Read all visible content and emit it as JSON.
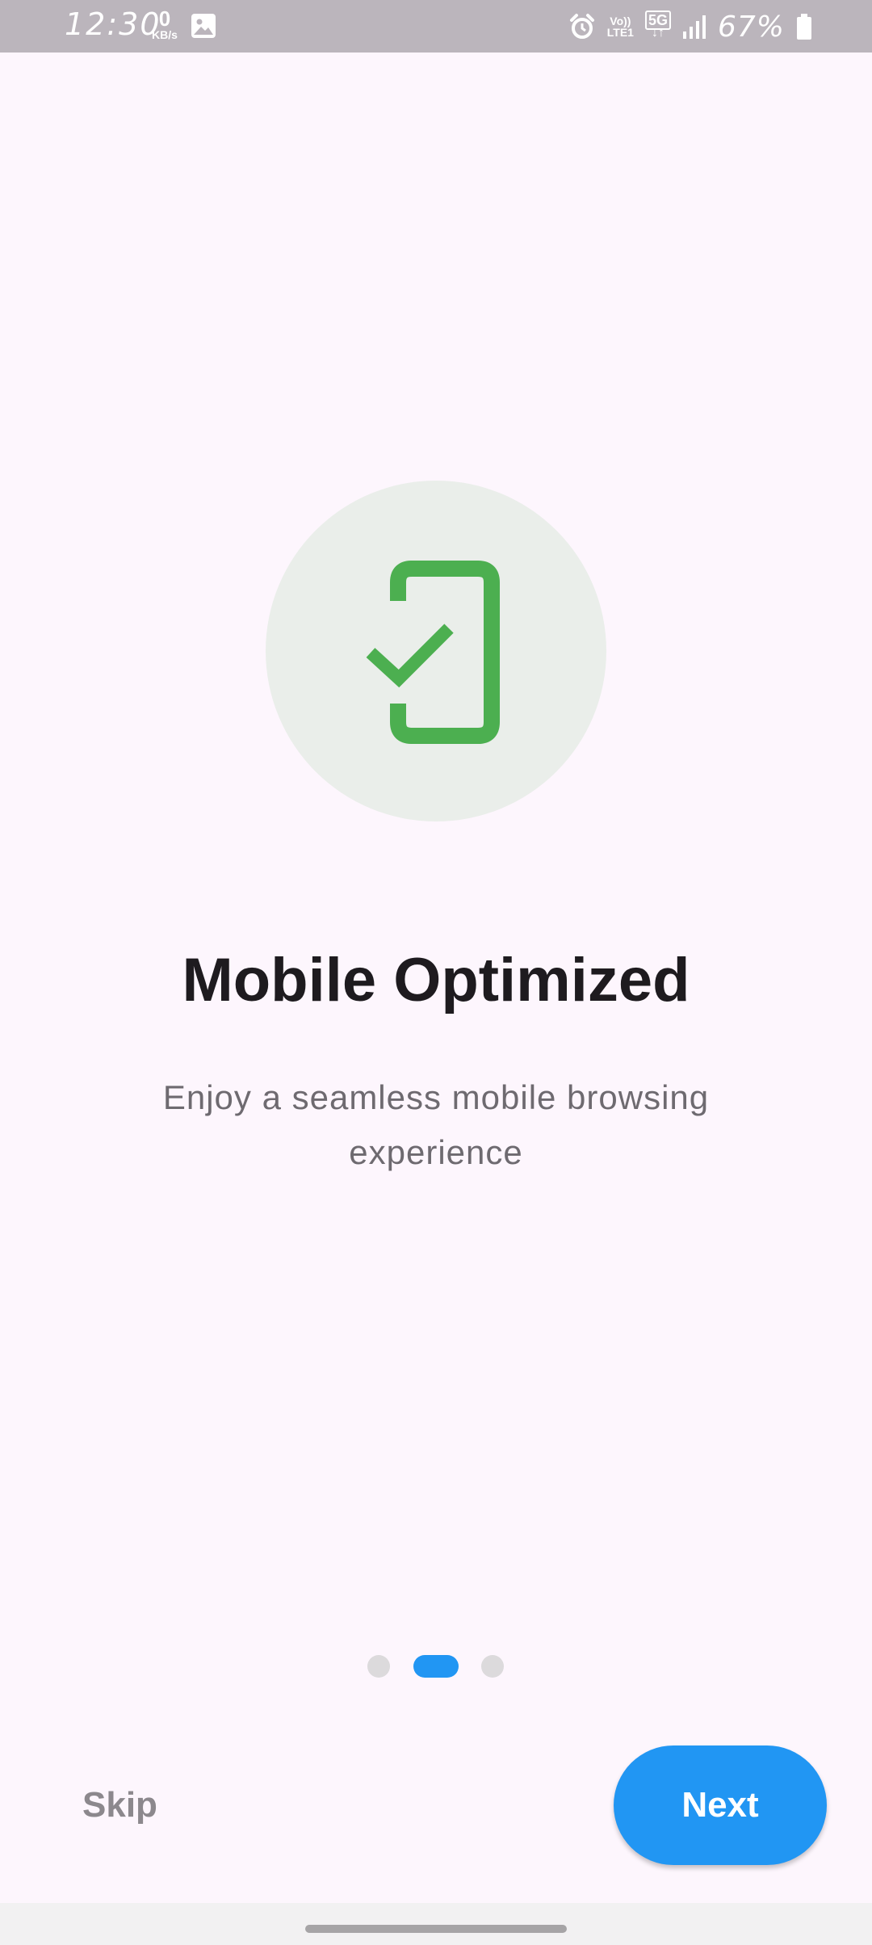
{
  "status_bar": {
    "time": "12:30",
    "speed_value": "0",
    "speed_unit": "KB/s",
    "network_top": "Vo))",
    "network_bottom": "LTE1",
    "network_type": "5G",
    "battery": "67%",
    "icons": [
      "gallery-icon",
      "alarm-icon",
      "volte-icon",
      "5g-data-icon",
      "signal-icon",
      "battery-icon"
    ]
  },
  "onboarding": {
    "icon": "mobile-check-icon",
    "accent_color": "#4caf50",
    "title": "Mobile Optimized",
    "description": "Enjoy a seamless mobile browsing experience",
    "page_indicator": {
      "total": 3,
      "current": 2,
      "active_color": "#2196f3"
    }
  },
  "actions": {
    "skip_label": "Skip",
    "next_label": "Next",
    "primary_color": "#2196f3"
  }
}
